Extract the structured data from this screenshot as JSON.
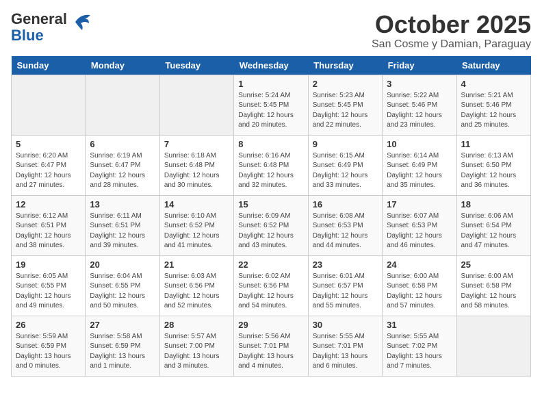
{
  "header": {
    "logo_line1": "General",
    "logo_line2": "Blue",
    "month": "October 2025",
    "location": "San Cosme y Damian, Paraguay"
  },
  "days_of_week": [
    "Sunday",
    "Monday",
    "Tuesday",
    "Wednesday",
    "Thursday",
    "Friday",
    "Saturday"
  ],
  "weeks": [
    [
      {
        "day": "",
        "info": ""
      },
      {
        "day": "",
        "info": ""
      },
      {
        "day": "",
        "info": ""
      },
      {
        "day": "1",
        "info": "Sunrise: 5:24 AM\nSunset: 5:45 PM\nDaylight: 12 hours and 20 minutes."
      },
      {
        "day": "2",
        "info": "Sunrise: 5:23 AM\nSunset: 5:45 PM\nDaylight: 12 hours and 22 minutes."
      },
      {
        "day": "3",
        "info": "Sunrise: 5:22 AM\nSunset: 5:46 PM\nDaylight: 12 hours and 23 minutes."
      },
      {
        "day": "4",
        "info": "Sunrise: 5:21 AM\nSunset: 5:46 PM\nDaylight: 12 hours and 25 minutes."
      }
    ],
    [
      {
        "day": "5",
        "info": "Sunrise: 6:20 AM\nSunset: 6:47 PM\nDaylight: 12 hours and 27 minutes."
      },
      {
        "day": "6",
        "info": "Sunrise: 6:19 AM\nSunset: 6:47 PM\nDaylight: 12 hours and 28 minutes."
      },
      {
        "day": "7",
        "info": "Sunrise: 6:18 AM\nSunset: 6:48 PM\nDaylight: 12 hours and 30 minutes."
      },
      {
        "day": "8",
        "info": "Sunrise: 6:16 AM\nSunset: 6:48 PM\nDaylight: 12 hours and 32 minutes."
      },
      {
        "day": "9",
        "info": "Sunrise: 6:15 AM\nSunset: 6:49 PM\nDaylight: 12 hours and 33 minutes."
      },
      {
        "day": "10",
        "info": "Sunrise: 6:14 AM\nSunset: 6:49 PM\nDaylight: 12 hours and 35 minutes."
      },
      {
        "day": "11",
        "info": "Sunrise: 6:13 AM\nSunset: 6:50 PM\nDaylight: 12 hours and 36 minutes."
      }
    ],
    [
      {
        "day": "12",
        "info": "Sunrise: 6:12 AM\nSunset: 6:51 PM\nDaylight: 12 hours and 38 minutes."
      },
      {
        "day": "13",
        "info": "Sunrise: 6:11 AM\nSunset: 6:51 PM\nDaylight: 12 hours and 39 minutes."
      },
      {
        "day": "14",
        "info": "Sunrise: 6:10 AM\nSunset: 6:52 PM\nDaylight: 12 hours and 41 minutes."
      },
      {
        "day": "15",
        "info": "Sunrise: 6:09 AM\nSunset: 6:52 PM\nDaylight: 12 hours and 43 minutes."
      },
      {
        "day": "16",
        "info": "Sunrise: 6:08 AM\nSunset: 6:53 PM\nDaylight: 12 hours and 44 minutes."
      },
      {
        "day": "17",
        "info": "Sunrise: 6:07 AM\nSunset: 6:53 PM\nDaylight: 12 hours and 46 minutes."
      },
      {
        "day": "18",
        "info": "Sunrise: 6:06 AM\nSunset: 6:54 PM\nDaylight: 12 hours and 47 minutes."
      }
    ],
    [
      {
        "day": "19",
        "info": "Sunrise: 6:05 AM\nSunset: 6:55 PM\nDaylight: 12 hours and 49 minutes."
      },
      {
        "day": "20",
        "info": "Sunrise: 6:04 AM\nSunset: 6:55 PM\nDaylight: 12 hours and 50 minutes."
      },
      {
        "day": "21",
        "info": "Sunrise: 6:03 AM\nSunset: 6:56 PM\nDaylight: 12 hours and 52 minutes."
      },
      {
        "day": "22",
        "info": "Sunrise: 6:02 AM\nSunset: 6:56 PM\nDaylight: 12 hours and 54 minutes."
      },
      {
        "day": "23",
        "info": "Sunrise: 6:01 AM\nSunset: 6:57 PM\nDaylight: 12 hours and 55 minutes."
      },
      {
        "day": "24",
        "info": "Sunrise: 6:00 AM\nSunset: 6:58 PM\nDaylight: 12 hours and 57 minutes."
      },
      {
        "day": "25",
        "info": "Sunrise: 6:00 AM\nSunset: 6:58 PM\nDaylight: 12 hours and 58 minutes."
      }
    ],
    [
      {
        "day": "26",
        "info": "Sunrise: 5:59 AM\nSunset: 6:59 PM\nDaylight: 13 hours and 0 minutes."
      },
      {
        "day": "27",
        "info": "Sunrise: 5:58 AM\nSunset: 6:59 PM\nDaylight: 13 hours and 1 minute."
      },
      {
        "day": "28",
        "info": "Sunrise: 5:57 AM\nSunset: 7:00 PM\nDaylight: 13 hours and 3 minutes."
      },
      {
        "day": "29",
        "info": "Sunrise: 5:56 AM\nSunset: 7:01 PM\nDaylight: 13 hours and 4 minutes."
      },
      {
        "day": "30",
        "info": "Sunrise: 5:55 AM\nSunset: 7:01 PM\nDaylight: 13 hours and 6 minutes."
      },
      {
        "day": "31",
        "info": "Sunrise: 5:55 AM\nSunset: 7:02 PM\nDaylight: 13 hours and 7 minutes."
      },
      {
        "day": "",
        "info": ""
      }
    ]
  ]
}
